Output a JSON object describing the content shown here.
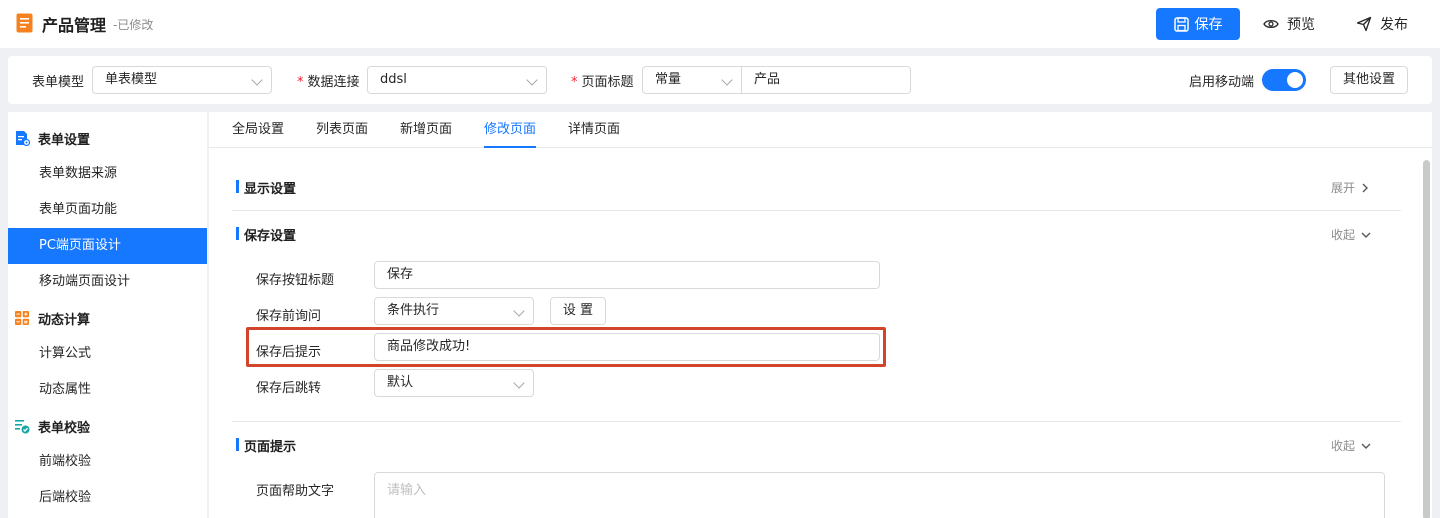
{
  "header": {
    "title": "产品管理",
    "status": "-已修改",
    "save_label": "保存",
    "preview_label": "预览",
    "publish_label": "发布",
    "accent_color": "#1677ff"
  },
  "config": {
    "form_model_label": "表单模型",
    "form_model_value": "单表模型",
    "data_conn_label": "数据连接",
    "data_conn_value": "ddsl",
    "page_title_label": "页面标题",
    "page_title_mode": "常量",
    "page_title_value": "产品",
    "mobile_label": "启用移动端",
    "mobile_enabled": true,
    "other_settings_label": "其他设置"
  },
  "sidebar": {
    "groups": [
      {
        "label": "表单设置",
        "icon": "form-settings-icon",
        "items": [
          "表单数据来源",
          "表单页面功能",
          "PC端页面设计",
          "移动端页面设计"
        ]
      },
      {
        "label": "动态计算",
        "icon": "calculator-icon",
        "items": [
          "计算公式",
          "动态属性"
        ]
      },
      {
        "label": "表单校验",
        "icon": "validation-icon",
        "items": [
          "前端校验",
          "后端校验"
        ]
      }
    ],
    "active_item": "PC端页面设计"
  },
  "tabs": {
    "items": [
      "全局设置",
      "列表页面",
      "新增页面",
      "修改页面",
      "详情页面"
    ],
    "active": "修改页面"
  },
  "sections": {
    "display": {
      "title": "显示设置",
      "toggle": "展开"
    },
    "save": {
      "title": "保存设置",
      "toggle": "收起",
      "button_title_label": "保存按钮标题",
      "button_title_value": "保存",
      "pre_confirm_label": "保存前询问",
      "pre_confirm_value": "条件执行",
      "settings_button": "设 置",
      "post_tip_label": "保存后提示",
      "post_tip_value": "商品修改成功!",
      "post_jump_label": "保存后跳转",
      "post_jump_value": "默认"
    },
    "page_tip": {
      "title": "页面提示",
      "toggle": "收起",
      "help_text_label": "页面帮助文字",
      "help_text_placeholder": "请输入"
    }
  },
  "highlight_color": "#d2452c"
}
